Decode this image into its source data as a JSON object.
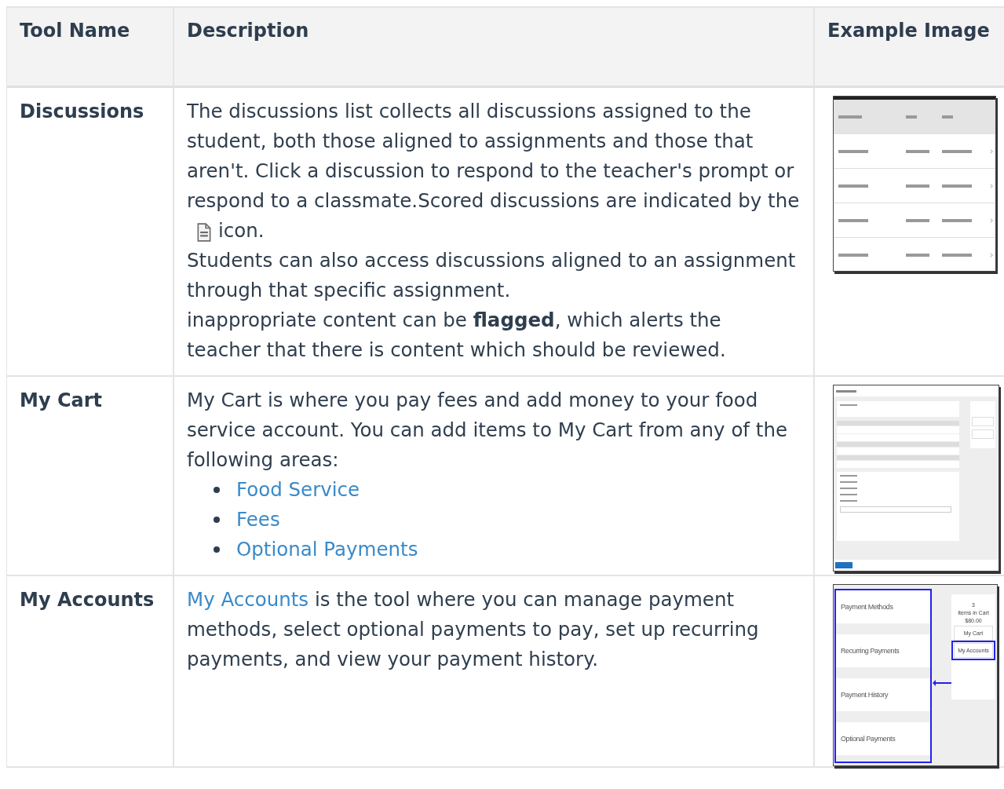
{
  "table": {
    "columns": [
      "Tool Name",
      "Description",
      "Example Image"
    ],
    "rows": [
      {
        "tool": "Discussions",
        "blocks": [
          {
            "kind": "text_with_icon",
            "before": "The discussions list collects all discussions assigned to the student, both those aligned to assignments and those that aren't. Click a discussion to respond to the teacher's prompt or respond to a classmate.Scored discussions are indicated by the",
            "after": "icon."
          },
          {
            "kind": "text",
            "text": "Students can also access discussions aligned to an assignment through that specific assignment."
          },
          {
            "kind": "text",
            "text": "inappropriate content can be **flagged**, which alerts the teacher that there is content which should be reviewed."
          }
        ],
        "example": {
          "kind": "discussion_list"
        }
      },
      {
        "tool": "My Cart",
        "blocks": [
          {
            "kind": "text",
            "text": "My Cart is where you pay fees and add money to your food service account. You can add items to My Cart from any of the following areas:"
          },
          {
            "kind": "links",
            "items": [
              "Food Service",
              "Fees",
              "Optional Payments"
            ]
          }
        ],
        "example": {
          "kind": "checkout"
        }
      },
      {
        "tool": "My Accounts",
        "blocks": [
          {
            "kind": "link_lead",
            "link": "My Accounts",
            "text": " is the tool where you can manage payment methods, select optional payments to pay, set up recurring payments, and view your payment history."
          }
        ],
        "example": {
          "kind": "accounts_menu",
          "items": [
            "Payment Methods",
            "Recurring Payments",
            "Payment History",
            "Optional Payments"
          ],
          "count": "3",
          "count_label": "Items in Cart",
          "total": "$80.00",
          "buttons": [
            "My Cart",
            "My Accounts"
          ]
        }
      }
    ]
  }
}
